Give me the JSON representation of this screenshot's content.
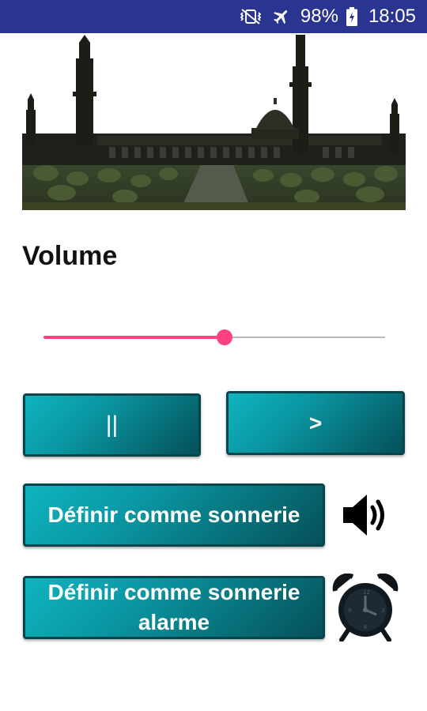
{
  "status_bar": {
    "battery": "98%",
    "time": "18:05",
    "icons": [
      "vibrate-mute-icon",
      "airplane-icon",
      "battery-charging-icon"
    ],
    "background": "#2a3592"
  },
  "banner": {
    "image": "mosque-silhouette"
  },
  "volume": {
    "title": "Volume",
    "level": 0.53,
    "accent": "#ff4081"
  },
  "controls": {
    "pause_label": "||",
    "play_label": ">",
    "ringtone_label": "Définir comme sonnerie",
    "alarm_label_line1": "Définir comme sonnerie",
    "alarm_label_line2": "alarme",
    "button_color": "#0a98a4"
  },
  "icons": {
    "ringtone_icon": "speaker-icon",
    "alarm_icon": "alarm-clock-icon"
  }
}
